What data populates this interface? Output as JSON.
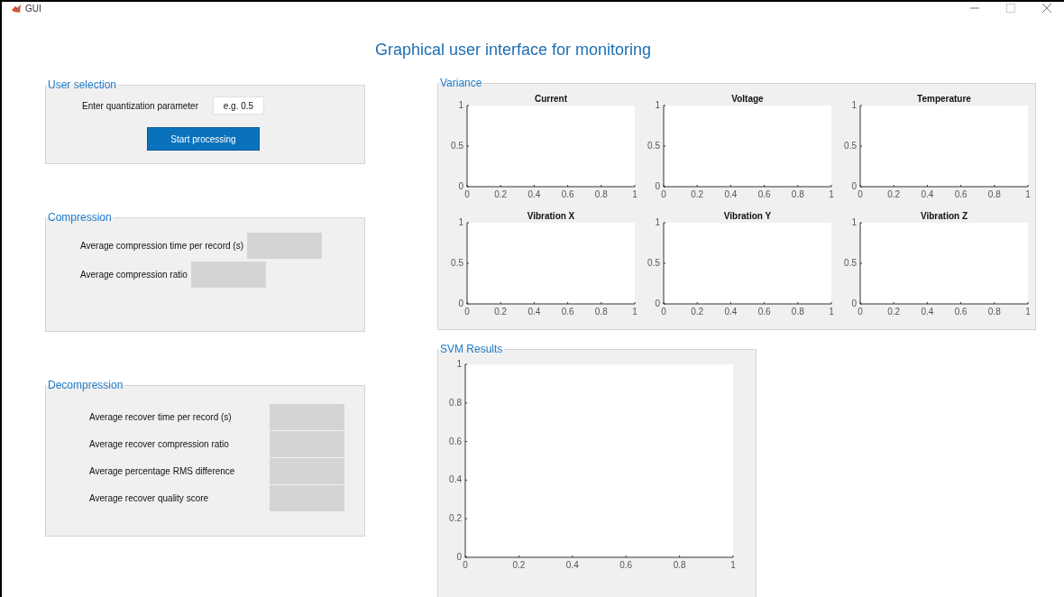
{
  "window": {
    "title": "GUI"
  },
  "heading": "Graphical user interface for monitoring",
  "user_selection": {
    "title": "User selection",
    "field": {
      "label": "Enter quantization parameter",
      "value": "e.g. 0.5"
    },
    "button": "Start processing"
  },
  "compression": {
    "title": "Compression",
    "outputs": [
      {
        "label": "Average compression time per record (s)"
      },
      {
        "label": "Average compression ratio"
      }
    ]
  },
  "decompression": {
    "title": "Decompression",
    "outputs": [
      {
        "label": "Average recover time per record (s)"
      },
      {
        "label": "Average recover compression ratio"
      },
      {
        "label": "Average percentage RMS difference"
      },
      {
        "label": "Average recover quality score"
      }
    ]
  },
  "variance": {
    "title": "Variance",
    "charts": [
      {
        "chart_data": {
          "type": "line",
          "title": "Current",
          "xlim": [
            0,
            1
          ],
          "ylim": [
            0,
            1
          ],
          "xticks": [
            0,
            0.2,
            0.4,
            0.6,
            0.8,
            1
          ],
          "yticks": [
            0,
            0.5,
            1
          ]
        }
      },
      {
        "chart_data": {
          "type": "line",
          "title": "Voltage",
          "xlim": [
            0,
            1
          ],
          "ylim": [
            0,
            1
          ],
          "xticks": [
            0,
            0.2,
            0.4,
            0.6,
            0.8,
            1
          ],
          "yticks": [
            0,
            0.5,
            1
          ]
        }
      },
      {
        "chart_data": {
          "type": "line",
          "title": "Temperature",
          "xlim": [
            0,
            1
          ],
          "ylim": [
            0,
            1
          ],
          "xticks": [
            0,
            0.2,
            0.4,
            0.6,
            0.8,
            1
          ],
          "yticks": [
            0,
            0.5,
            1
          ]
        }
      },
      {
        "chart_data": {
          "type": "line",
          "title": "Vibration X",
          "xlim": [
            0,
            1
          ],
          "ylim": [
            0,
            1
          ],
          "xticks": [
            0,
            0.2,
            0.4,
            0.6,
            0.8,
            1
          ],
          "yticks": [
            0,
            0.5,
            1
          ]
        }
      },
      {
        "chart_data": {
          "type": "line",
          "title": "Vibration Y",
          "xlim": [
            0,
            1
          ],
          "ylim": [
            0,
            1
          ],
          "xticks": [
            0,
            0.2,
            0.4,
            0.6,
            0.8,
            1
          ],
          "yticks": [
            0,
            0.5,
            1
          ]
        }
      },
      {
        "chart_data": {
          "type": "line",
          "title": "Vibration Z",
          "xlim": [
            0,
            1
          ],
          "ylim": [
            0,
            1
          ],
          "xticks": [
            0,
            0.2,
            0.4,
            0.6,
            0.8,
            1
          ],
          "yticks": [
            0,
            0.5,
            1
          ]
        }
      }
    ]
  },
  "svm_results": {
    "title": "SVM Results",
    "chart_data": {
      "type": "line",
      "xlim": [
        0,
        1
      ],
      "ylim": [
        0,
        1
      ],
      "xticks": [
        0,
        0.2,
        0.4,
        0.6,
        0.8,
        1
      ],
      "yticks": [
        0,
        0.2,
        0.4,
        0.6,
        0.8,
        1
      ]
    }
  }
}
